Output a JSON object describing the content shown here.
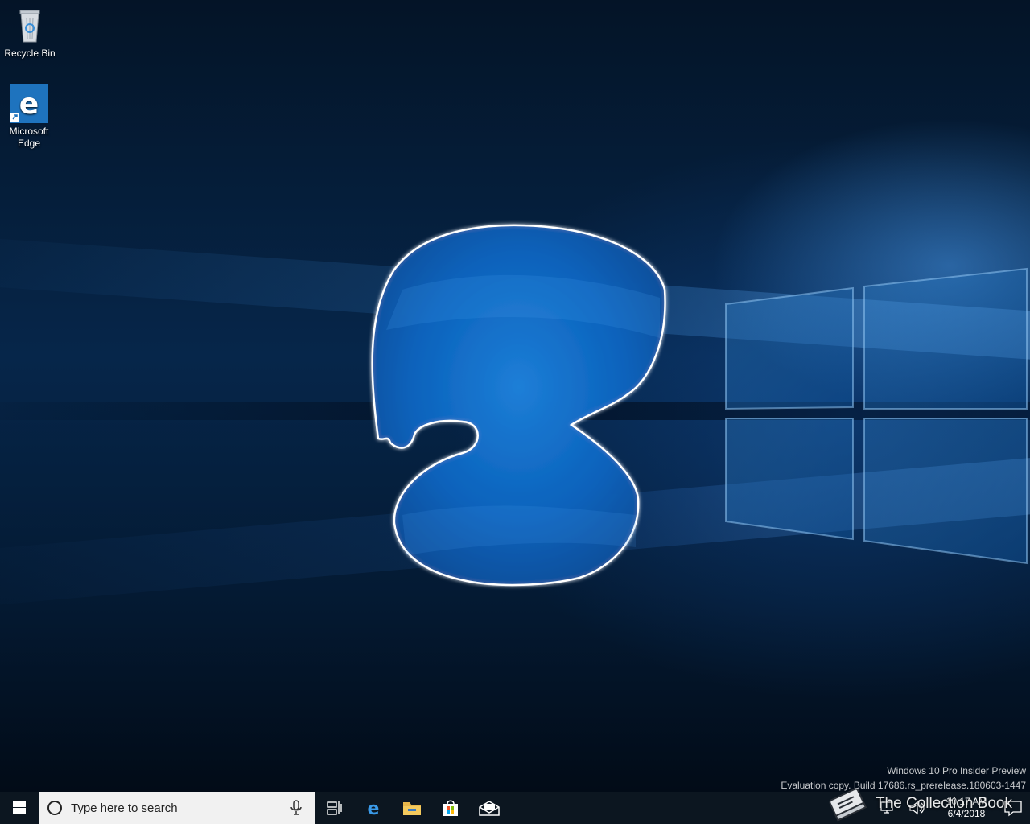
{
  "desktop": {
    "icons": [
      {
        "label": "Recycle Bin",
        "icon": "recycle-bin-icon"
      },
      {
        "label_line1": "Microsoft",
        "label_line2": "Edge",
        "icon": "edge-icon"
      }
    ],
    "watermark": {
      "line1": "Windows 10 Pro Insider Preview",
      "line2": "Evaluation copy. Build 17686.rs_prerelease.180603-1447"
    }
  },
  "taskbar": {
    "search_placeholder": "Type here to search",
    "pinned": [
      "task-view-icon",
      "edge-icon",
      "file-explorer-icon",
      "store-icon",
      "mail-icon"
    ],
    "clock": {
      "time": "10:17 AM",
      "date": "6/4/2018"
    }
  },
  "overlay": {
    "brand": "The Collection Book",
    "brand_icon": "book-icon"
  },
  "colors": {
    "accent": "#0078d7",
    "taskbar": "#0c1620",
    "search_bg": "#f1f1f1"
  }
}
